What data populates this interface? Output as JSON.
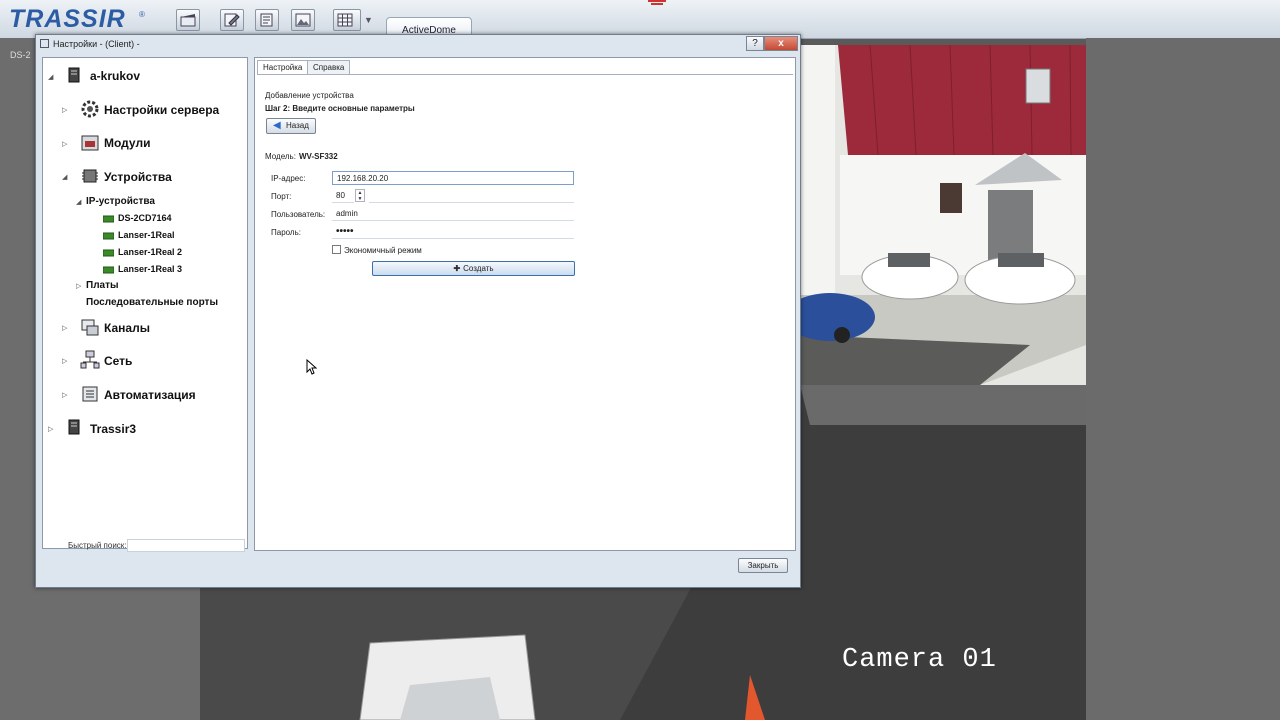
{
  "app": {
    "logo": "TRASSIR",
    "logo_mark": "®",
    "active_tab": "ActiveDome",
    "toolbar_icons": [
      "clapper-icon",
      "edit-icon",
      "document-icon",
      "picture-icon",
      "grid-icon"
    ]
  },
  "camera": {
    "overlay_label": "Camera 01",
    "left_label": "DS-2"
  },
  "window": {
    "title": "Настройки - (Client) -",
    "help_glyph": "?",
    "close_glyph": "x",
    "close_button": "Закрыть"
  },
  "tree": {
    "root": "a-krukov",
    "items": [
      {
        "label": "Настройки сервера",
        "icon": "gear-icon"
      },
      {
        "label": "Модули",
        "icon": "modules-icon"
      },
      {
        "label": "Устройства",
        "icon": "chip-icon"
      }
    ],
    "ip_devices": {
      "label": "IP-устройства",
      "devices": [
        "DS-2CD7164",
        "Lanser-1Real",
        "Lanser-1Real 2",
        "Lanser-1Real 3"
      ]
    },
    "boards": "Платы",
    "serial_ports": "Последовательные порты",
    "channels": "Каналы",
    "network": "Сеть",
    "automation": "Автоматизация",
    "second_server": "Trassir3",
    "quick_search_label": "Быстрый поиск:"
  },
  "pane": {
    "tabs": [
      "Настройка",
      "Справка"
    ],
    "section_title": "Добавление устройства",
    "step_title": "Шаг 2: Введите основные параметры",
    "back_button": "Назад",
    "model_label": "Модель:",
    "model_value": "WV-SF332",
    "ip_label": "IP-адрес:",
    "ip_value": "192.168.20.20",
    "port_label": "Порт:",
    "port_value": "80",
    "user_label": "Пользователь:",
    "user_value": "admin",
    "password_label": "Пароль:",
    "password_value": "•••••",
    "eco_mode_label": "Экономичный режим",
    "eco_mode_checked": false,
    "create_button": "Создать"
  },
  "colors": {
    "brand": "#2c5da4",
    "close_red": "#c24a33"
  }
}
